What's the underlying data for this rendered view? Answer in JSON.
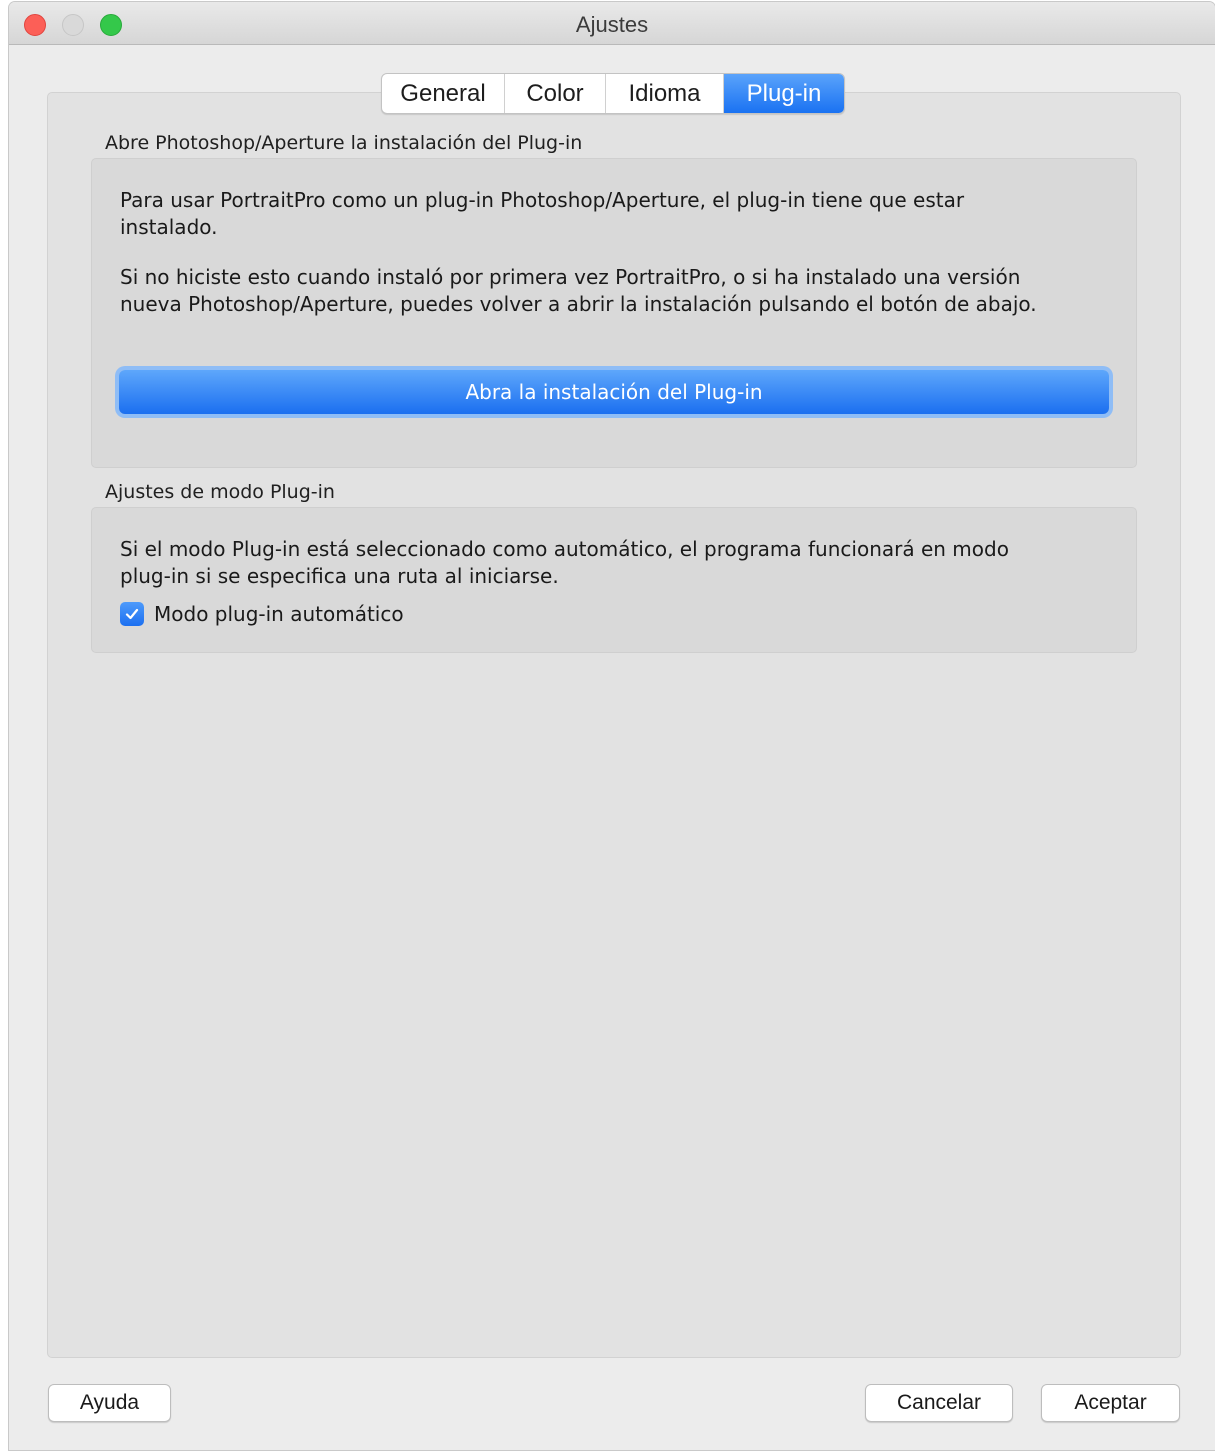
{
  "window": {
    "title": "Ajustes",
    "traffic_lights": {
      "close": "#fc5f57",
      "minimize": "#d9d9d9",
      "maximize": "#34c84a"
    }
  },
  "tabs": [
    {
      "label": "General",
      "active": false
    },
    {
      "label": "Color",
      "active": false
    },
    {
      "label": "Idioma",
      "active": false
    },
    {
      "label": "Plug-in",
      "active": true
    }
  ],
  "install_section": {
    "label": "Abre Photoshop/Aperture la instalación del Plug-in",
    "paragraph1": "Para usar PortraitPro como un plug-in Photoshop/Aperture, el plug-in tiene que estar\ninstalado.",
    "paragraph2": "Si no hiciste esto cuando instaló por primera vez PortraitPro, o si ha instalado una versión\nnueva Photoshop/Aperture, puedes volver a abrir la instalación pulsando el botón de abajo.",
    "button_label": "Abra la instalación del Plug-in"
  },
  "mode_section": {
    "label": "Ajustes de modo Plug-in",
    "paragraph": "Si el modo Plug-in está seleccionado como automático, el programa funcionará en modo\nplug-in si se especifica una ruta al iniciarse.",
    "checkbox_label": "Modo plug-in automático",
    "checkbox_checked": true
  },
  "footer": {
    "help_label": "Ayuda",
    "cancel_label": "Cancelar",
    "accept_label": "Aceptar"
  },
  "colors": {
    "accent": "#1a72f2"
  }
}
